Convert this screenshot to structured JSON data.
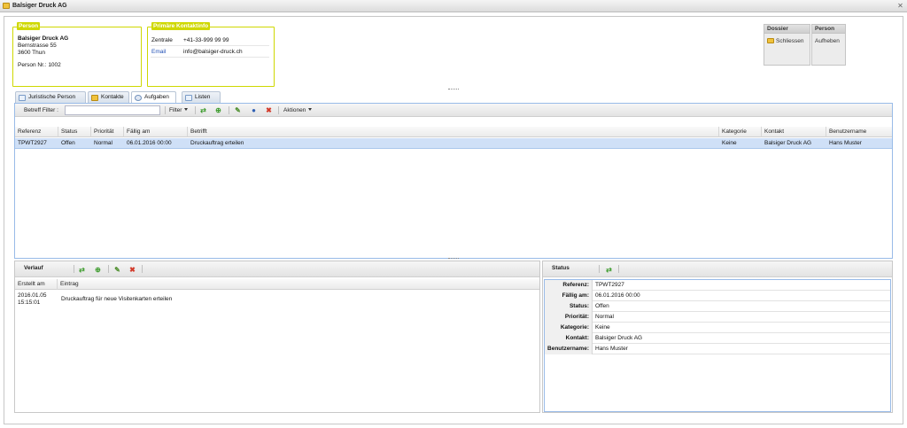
{
  "window": {
    "title": "Balsiger Druck AG"
  },
  "person_box": {
    "legend": "Person",
    "name": "Balsiger Druck AG",
    "street": "Bernstrasse 55",
    "city": "3600 Thun",
    "number": "Person Nr.: 1002"
  },
  "contact_box": {
    "legend": "Primäre Kontaktinfo",
    "phone_label": "Zentrale",
    "phone_value": "+41-33-999 99 99",
    "email_label": "Email",
    "email_value": "info@balsiger-druck.ch"
  },
  "actions": {
    "dossier_header": "Dossier",
    "dossier_button": "Schliessen",
    "person_header": "Person",
    "person_button": "Aufheben"
  },
  "tabs": [
    {
      "label": "Juristische Person",
      "icon": "document-icon"
    },
    {
      "label": "Kontakte",
      "icon": "contacts-icon"
    },
    {
      "label": "Aufgaben",
      "icon": "tasks-icon"
    },
    {
      "label": "Listen",
      "icon": "list-icon"
    }
  ],
  "tasks_toolbar": {
    "filter_label": "Betreff Filter :",
    "filter_value": "",
    "filter_button": "Filter",
    "actions_button": "Aktionen"
  },
  "tasks_grid": {
    "columns": [
      "Referenz",
      "Status",
      "Priorität",
      "Fällig am",
      "Betrifft",
      "Kategorie",
      "Kontakt",
      "Benutzername"
    ],
    "rows": [
      [
        "TPWT2927",
        "Offen",
        "Normal",
        "06.01.2016 00:00",
        "Druckauftrag erteilen",
        "Keine",
        "Balsiger Druck AG",
        "Hans Muster"
      ]
    ]
  },
  "history": {
    "title": "Verlauf",
    "columns": [
      "Erstellt am",
      "Eintrag"
    ],
    "rows": [
      {
        "date": "2016.01.05",
        "time": "15:15:01",
        "entry": "Druckauftrag für neue Visitenkarten erteilen"
      }
    ]
  },
  "status_panel": {
    "title": "Status",
    "properties": [
      {
        "name": "Referenz:",
        "value": "TPWT2927"
      },
      {
        "name": "Fällig am:",
        "value": "06.01.2016 00:00"
      },
      {
        "name": "Status:",
        "value": "Offen"
      },
      {
        "name": "Priorität:",
        "value": "Normal"
      },
      {
        "name": "Kategorie:",
        "value": "Keine"
      },
      {
        "name": "Kontakt:",
        "value": "Balsiger Druck AG"
      },
      {
        "name": "Benutzername:",
        "value": "Hans Muster"
      }
    ]
  },
  "colors": {
    "accent_box": "#cfd800",
    "selection": "#cfe0f7",
    "panel_border": "#99bbe8"
  }
}
